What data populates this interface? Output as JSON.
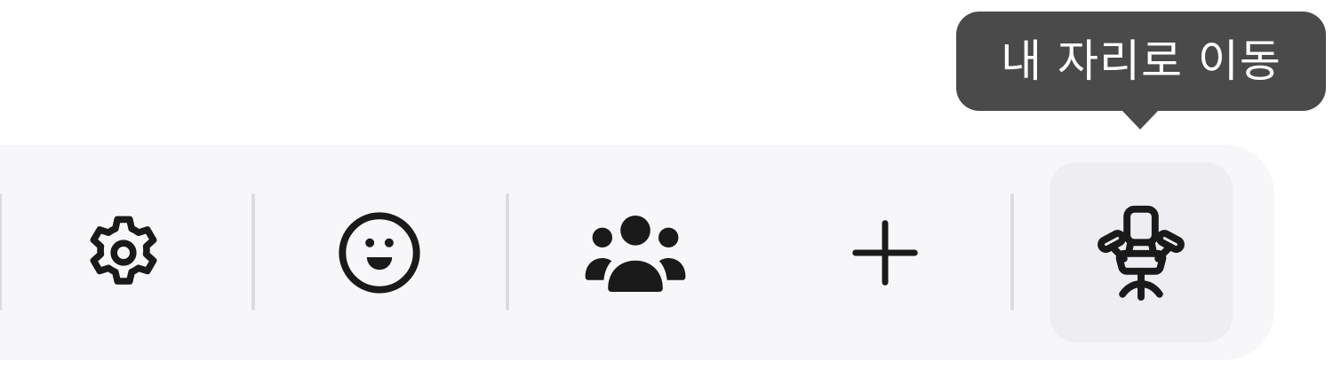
{
  "tooltip": {
    "text": "내 자리로 이동"
  },
  "toolbar": {
    "buttons": [
      {
        "icon": "gear-icon",
        "label": "settings"
      },
      {
        "icon": "smiley-icon",
        "label": "emoji"
      },
      {
        "icon": "people-icon",
        "label": "members"
      },
      {
        "icon": "plus-icon",
        "label": "add"
      },
      {
        "icon": "office-chair-icon",
        "label": "my-seat",
        "active": true
      }
    ]
  },
  "colors": {
    "tooltip_bg": "#4a4a4a",
    "toolbar_bg": "#f7f7f9",
    "active_bg": "#eeedf2",
    "icon": "#1a1a1a",
    "divider": "#dcdcde"
  }
}
